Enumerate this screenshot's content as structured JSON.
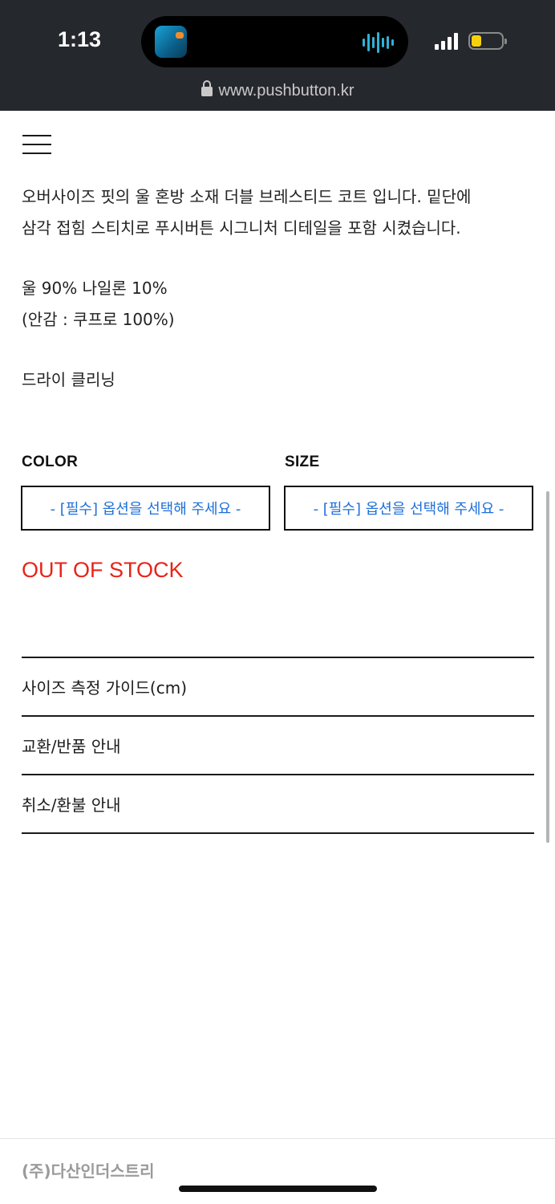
{
  "status_bar": {
    "time": "1:13",
    "url": "www.pushbutton.kr"
  },
  "product": {
    "description": [
      "오버사이즈 핏의 울 혼방 소재 더블 브레스티드 코트 입니다. 밑단에",
      "삼각 접힘 스티치로 푸시버튼 시그니처 디테일을 포함 시켰습니다.",
      "",
      "울 90% 나일론 10%",
      "(안감 : 쿠프로 100%)",
      "",
      "드라이 클리닝"
    ]
  },
  "options": {
    "color_label": "COLOR",
    "size_label": "SIZE",
    "color_placeholder": "- [필수] 옵션을 선택해 주세요 -",
    "size_placeholder": "- [필수] 옵션을 선택해 주세요 -"
  },
  "stock_status": "OUT OF STOCK",
  "accordion": [
    {
      "label": "사이즈 측정 가이드(cm)"
    },
    {
      "label": "교환/반품 안내"
    },
    {
      "label": "취소/환불 안내"
    }
  ],
  "footer": {
    "company": "(주)다산인더스트리"
  },
  "colors": {
    "status_bar_bg": "#25282d",
    "select_text": "#1e6fd9",
    "out_of_stock": "#e8231a"
  }
}
